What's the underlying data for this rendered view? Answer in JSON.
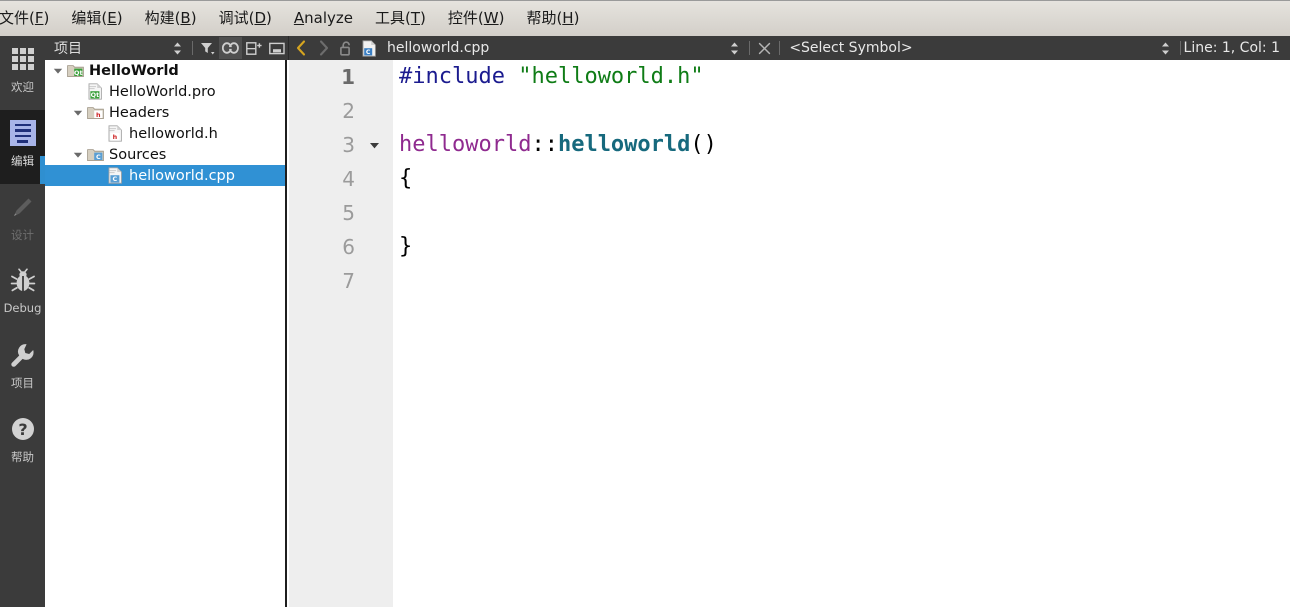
{
  "menubar": {
    "items": [
      {
        "name": "file",
        "pre": "文件(",
        "key": "F",
        "post": ")"
      },
      {
        "name": "edit",
        "pre": "编辑(",
        "key": "E",
        "post": ")"
      },
      {
        "name": "build",
        "pre": "构建(",
        "key": "B",
        "post": ")"
      },
      {
        "name": "debug",
        "pre": "调试(",
        "key": "D",
        "post": ")"
      },
      {
        "name": "analyze",
        "pre": "",
        "key": "A",
        "post": "nalyze"
      },
      {
        "name": "tools",
        "pre": "工具(",
        "key": "T",
        "post": ")"
      },
      {
        "name": "widgets",
        "pre": "控件(",
        "key": "W",
        "post": ")"
      },
      {
        "name": "help",
        "pre": "帮助(",
        "key": "H",
        "post": ")"
      }
    ]
  },
  "modebar": {
    "items": [
      {
        "name": "welcome",
        "label": "欢迎",
        "icon": "grid-icon",
        "state": "normal"
      },
      {
        "name": "edit",
        "label": "编辑",
        "icon": "edit-icon",
        "state": "active"
      },
      {
        "name": "design",
        "label": "设计",
        "icon": "pencil-icon",
        "state": "disabled"
      },
      {
        "name": "debug",
        "label": "Debug",
        "icon": "bug-icon",
        "state": "normal"
      },
      {
        "name": "projects",
        "label": "项目",
        "icon": "wrench-icon",
        "state": "normal"
      },
      {
        "name": "help",
        "label": "帮助",
        "icon": "question-icon",
        "state": "normal"
      }
    ]
  },
  "toolbar": {
    "project_title": "项目",
    "project_buttons": [
      {
        "name": "sync-updown-button",
        "icon": "up-down-arrows-icon"
      },
      {
        "name": "filter-button",
        "icon": "filter-funnel-icon"
      },
      {
        "name": "link-with-editor-button",
        "icon": "chain-link-icon",
        "pressed": true
      },
      {
        "name": "split-add-button",
        "icon": "split-pane-plus-icon"
      },
      {
        "name": "close-pane-button",
        "icon": "close-pane-icon"
      }
    ],
    "nav_back": "back-arrow-icon",
    "nav_forward": "forward-arrow-icon",
    "lock_icon": "unlocked-padlock-icon",
    "file_icon": "cpp-file-icon",
    "filename": "helloworld.cpp",
    "file_selector_icon": "up-down-arrows-icon",
    "close_file_icon": "close-x-icon",
    "symbol_placeholder": "<Select Symbol>",
    "symbol_selector_icon": "up-down-arrows-icon",
    "cursor_position": "Line: 1, Col: 1"
  },
  "tree": {
    "rows": [
      {
        "name": "project-root",
        "label": "HelloWorld",
        "indent": 0,
        "arrow": "expanded",
        "icon": "qt-folder-icon",
        "bold": true,
        "selected": false
      },
      {
        "name": "file-pro",
        "label": "HelloWorld.pro",
        "indent": 1,
        "arrow": "none",
        "icon": "qt-pro-file-icon",
        "bold": false,
        "selected": false
      },
      {
        "name": "folder-headers",
        "label": "Headers",
        "indent": 1,
        "arrow": "expanded",
        "icon": "h-folder-icon",
        "bold": false,
        "selected": false
      },
      {
        "name": "file-header",
        "label": "helloworld.h",
        "indent": 2,
        "arrow": "none",
        "icon": "h-file-icon",
        "bold": false,
        "selected": false
      },
      {
        "name": "folder-sources",
        "label": "Sources",
        "indent": 1,
        "arrow": "expanded",
        "icon": "cpp-folder-icon",
        "bold": false,
        "selected": false
      },
      {
        "name": "file-source",
        "label": "helloworld.cpp",
        "indent": 2,
        "arrow": "none",
        "icon": "cpp-file-icon",
        "bold": false,
        "selected": true
      }
    ]
  },
  "editor": {
    "lines": [
      {
        "num": "1",
        "current": true,
        "fold": false,
        "tokens": [
          {
            "t": "pre",
            "v": "#include"
          },
          {
            "t": "pun",
            "v": " "
          },
          {
            "t": "str",
            "v": "\"helloworld.h\""
          }
        ]
      },
      {
        "num": "2",
        "current": false,
        "fold": false,
        "tokens": []
      },
      {
        "num": "3",
        "current": false,
        "fold": true,
        "tokens": [
          {
            "t": "cls",
            "v": "helloworld"
          },
          {
            "t": "pun",
            "v": "::"
          },
          {
            "t": "fn",
            "v": "helloworld"
          },
          {
            "t": "pun",
            "v": "()"
          }
        ]
      },
      {
        "num": "4",
        "current": false,
        "fold": false,
        "tokens": [
          {
            "t": "pun",
            "v": "{"
          }
        ]
      },
      {
        "num": "5",
        "current": false,
        "fold": false,
        "tokens": []
      },
      {
        "num": "6",
        "current": false,
        "fold": false,
        "tokens": [
          {
            "t": "pun",
            "v": "}"
          }
        ]
      },
      {
        "num": "7",
        "current": false,
        "fold": false,
        "tokens": []
      }
    ]
  },
  "colors": {
    "selection_blue": "#3091d4",
    "accent_blue": "#2f8fd0",
    "toolbar_dark": "#3b3b3b",
    "modebar_dark": "#3b3b3b",
    "mode_active_dark": "#1e1e1e",
    "gutter_grey": "#eeeeee",
    "menubar_grey": "#dcd9d3",
    "preprocessor": "#1b1b8f",
    "string": "#0f7c16",
    "class_name": "#8f2a8f",
    "function_name": "#16697d"
  }
}
